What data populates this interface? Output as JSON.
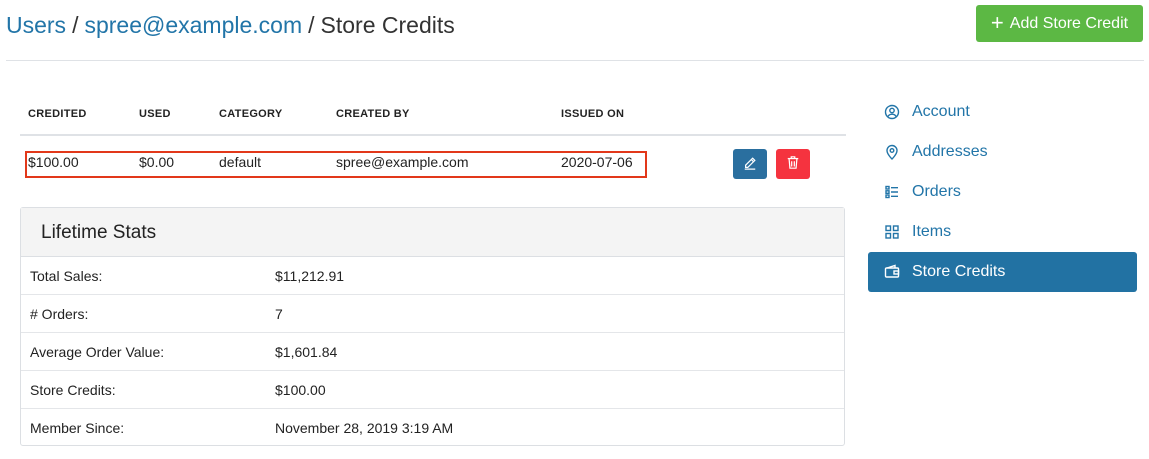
{
  "breadcrumb": {
    "users": "Users",
    "email": "spree@example.com",
    "current": "Store Credits",
    "separator": "/"
  },
  "add_button": {
    "label": "Add Store Credit",
    "icon": "plus-icon"
  },
  "table": {
    "headers": [
      "CREDITED",
      "USED",
      "CATEGORY",
      "CREATED BY",
      "ISSUED ON"
    ],
    "rows": [
      {
        "credited": "$100.00",
        "used": "$0.00",
        "category": "default",
        "created_by": "spree@example.com",
        "issued_on": "2020-07-06"
      }
    ]
  },
  "stats": {
    "title": "Lifetime Stats",
    "rows": [
      {
        "label": "Total Sales:",
        "value": "$11,212.91"
      },
      {
        "label": "# Orders:",
        "value": "7"
      },
      {
        "label": "Average Order Value:",
        "value": "$1,601.84"
      },
      {
        "label": "Store Credits:",
        "value": "$100.00"
      },
      {
        "label": "Member Since:",
        "value": "November 28, 2019 3:19 AM"
      }
    ]
  },
  "sidebar": {
    "items": [
      {
        "label": "Account",
        "icon": "user-circle-icon",
        "active": false
      },
      {
        "label": "Addresses",
        "icon": "map-pin-icon",
        "active": false
      },
      {
        "label": "Orders",
        "icon": "list-icon",
        "active": false
      },
      {
        "label": "Items",
        "icon": "grid-icon",
        "active": false
      },
      {
        "label": "Store Credits",
        "icon": "wallet-icon",
        "active": true
      }
    ]
  },
  "colors": {
    "link": "#2275a8",
    "add_button": "#5cb844",
    "edit_button": "#2a6f9f",
    "delete_button": "#f5333f",
    "active_nav": "#2272a3",
    "highlight": "#e2381a"
  }
}
